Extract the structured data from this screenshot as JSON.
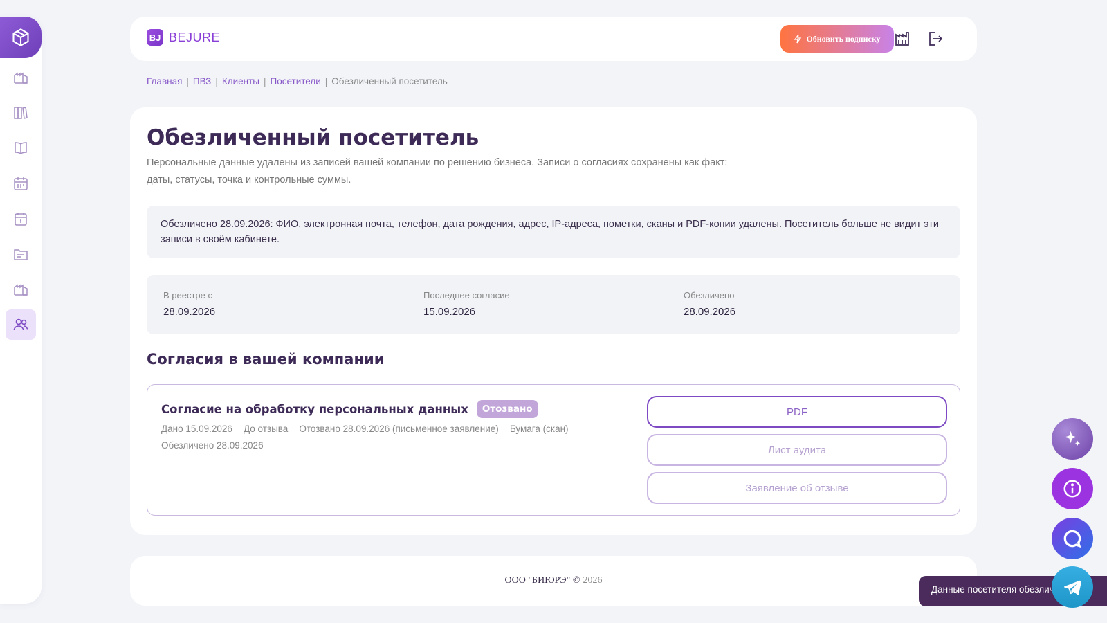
{
  "header": {
    "logo_mark": "BJ",
    "logo_text": "BEJURE",
    "upgrade_label": "Обновить подписку"
  },
  "breadcrumb": {
    "items": [
      "Главная",
      "ПВЗ",
      "Клиенты",
      "Посетители"
    ],
    "current": "Обезличенный посетитель"
  },
  "page": {
    "title": "Обезличенный посетитель",
    "description": "Персональные данные удалены из записей вашей компании по решению бизнеса. Записи о согласиях сохранены как факт: даты, статусы, точка и контрольные суммы.",
    "notice": "Обезличено 28.09.2026: ФИО, электронная почта, телефон, дата рождения, адрес, IP-адреса, пометки, сканы и PDF-копии удалены. Посетитель больше не видит эти записи в своём кабинете."
  },
  "stats": [
    {
      "label": "В реестре с",
      "value": "28.09.2026"
    },
    {
      "label": "Последнее согласие",
      "value": "15.09.2026"
    },
    {
      "label": "Обезличено",
      "value": "28.09.2026"
    }
  ],
  "consents": {
    "section_title": "Согласия в вашей компании",
    "items": [
      {
        "title": "Согласие на обработку персональных данных",
        "status": "Отозвано",
        "given": "Дано 15.09.2026",
        "term": "До отзыва",
        "revoked": "Отозвано 28.09.2026 (письменное заявление)",
        "medium": "Бумага (скан)",
        "anonymized": "Обезличено 28.09.2026",
        "buttons": [
          "PDF",
          "Лист аудита",
          "Заявление об отзыве"
        ]
      }
    ]
  },
  "footer": {
    "company": "ООО \"БИЮРЭ\" ©",
    "year": "2026"
  },
  "toast": {
    "text": "Данные посетителя обезличены"
  },
  "colors": {
    "accent": "#8a3fd6",
    "text": "#3d2a57",
    "badge": "#c2a6d9"
  }
}
